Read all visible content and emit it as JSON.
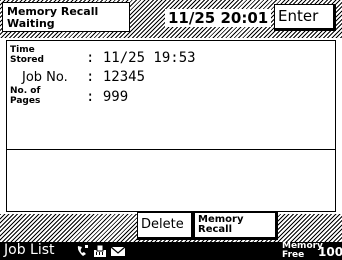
{
  "header": {
    "title_line1": "Memory Recall",
    "title_line2": "Waiting",
    "datetime": "11/25 20:01",
    "enter_label": "Enter"
  },
  "details": {
    "time_stored_label_line1": "Time",
    "time_stored_label_line2": "Stored",
    "time_stored_value": ": 11/25 19:53",
    "job_no_label": "Job No.",
    "job_no_value": ": 12345",
    "pages_label_line1": "No. of",
    "pages_label_line2": "Pages",
    "pages_value": ": 999"
  },
  "actions": {
    "delete_label": "Delete",
    "memory_recall_line1": "Memory",
    "memory_recall_line2": "Recall"
  },
  "status_bar": {
    "job_list_label": "Job List",
    "memory_free_line1": "Memory",
    "memory_free_line2": "Free",
    "memory_free_percent": "100%",
    "icons": [
      "phone-icon",
      "fax-machine-icon",
      "mail-icon"
    ]
  }
}
